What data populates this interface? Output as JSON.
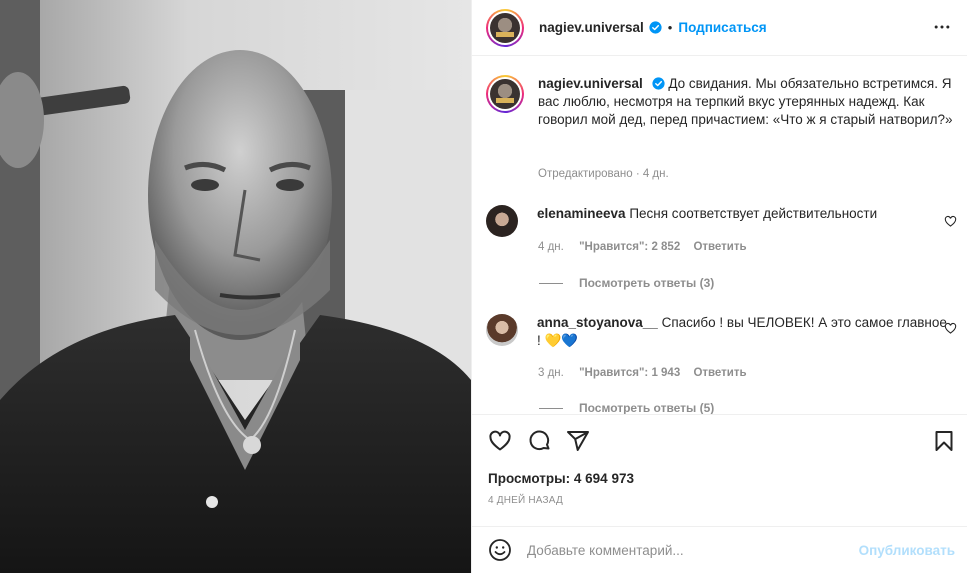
{
  "post": {
    "username": "nagiev.universal",
    "verified": true,
    "follow_label": "Подписаться",
    "separator": "•",
    "caption": "До свидания. Мы обязательно встретимся. Я вас люблю, несмотря на терпкий вкус утерянных надежд. Как говорил мой дед, перед причастием: «Что ж я старый натворил?»",
    "edited_label": "Отредактировано · 4 дн."
  },
  "comments": [
    {
      "username": "elenamineeva",
      "text": "Песня соответствует действительности",
      "age": "4 дн.",
      "likes": "\"Нравится\": 2 852",
      "reply_label": "Ответить",
      "view_replies": "Посмотреть ответы (3)"
    },
    {
      "username": "anna_stoyanova__",
      "text": "Спасибо ! вы ЧЕЛОВЕК! А это самое главное ! 💛💙",
      "age": "3 дн.",
      "likes": "\"Нравится\": 1 943",
      "reply_label": "Ответить",
      "view_replies": "Посмотреть ответы (5)"
    }
  ],
  "stats": {
    "views_label": "Просмотры:",
    "views_value": "4 694 973",
    "posted": "4 ДНЕЙ НАЗАД"
  },
  "composer": {
    "placeholder": "Добавьте комментарий...",
    "publish_label": "Опубликовать"
  },
  "colors": {
    "accent": "#0095f6",
    "publish_disabled": "#b2dffc",
    "muted": "#8e8e8e",
    "border": "#efefef"
  },
  "icons": [
    "verified-badge-icon",
    "more-options-icon",
    "heart-icon",
    "comment-icon",
    "share-icon",
    "bookmark-icon",
    "emoji-icon",
    "like-comment-icon"
  ]
}
